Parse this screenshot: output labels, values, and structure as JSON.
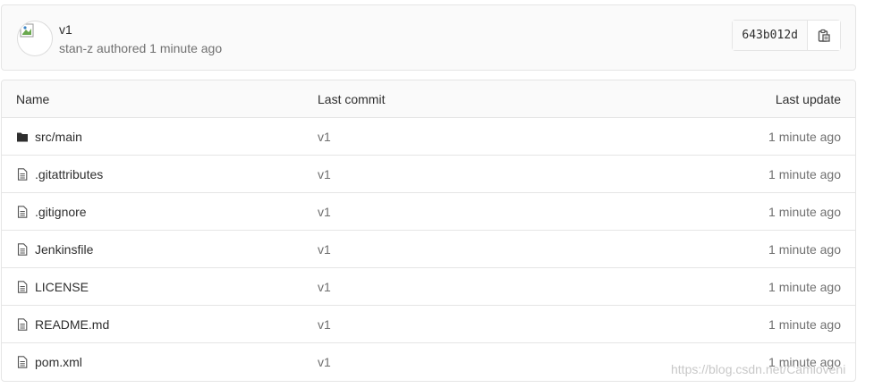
{
  "commit": {
    "title": "v1",
    "meta": "stan-z authored 1 minute ago",
    "sha": "643b012d"
  },
  "table": {
    "headers": {
      "name": "Name",
      "last_commit": "Last commit",
      "last_update": "Last update"
    },
    "rows": [
      {
        "name": "src/main",
        "icon": "folder-icon",
        "commit": "v1",
        "update": "1 minute ago"
      },
      {
        "name": ".gitattributes",
        "icon": "file-icon",
        "commit": "v1",
        "update": "1 minute ago"
      },
      {
        "name": ".gitignore",
        "icon": "file-icon",
        "commit": "v1",
        "update": "1 minute ago"
      },
      {
        "name": "Jenkinsfile",
        "icon": "file-icon",
        "commit": "v1",
        "update": "1 minute ago"
      },
      {
        "name": "LICENSE",
        "icon": "file-icon",
        "commit": "v1",
        "update": "1 minute ago"
      },
      {
        "name": "README.md",
        "icon": "file-icon",
        "commit": "v1",
        "update": "1 minute ago"
      },
      {
        "name": "pom.xml",
        "icon": "file-icon",
        "commit": "v1",
        "update": "1 minute ago"
      }
    ]
  },
  "watermark": "https://blog.csdn.net/Camloveni"
}
